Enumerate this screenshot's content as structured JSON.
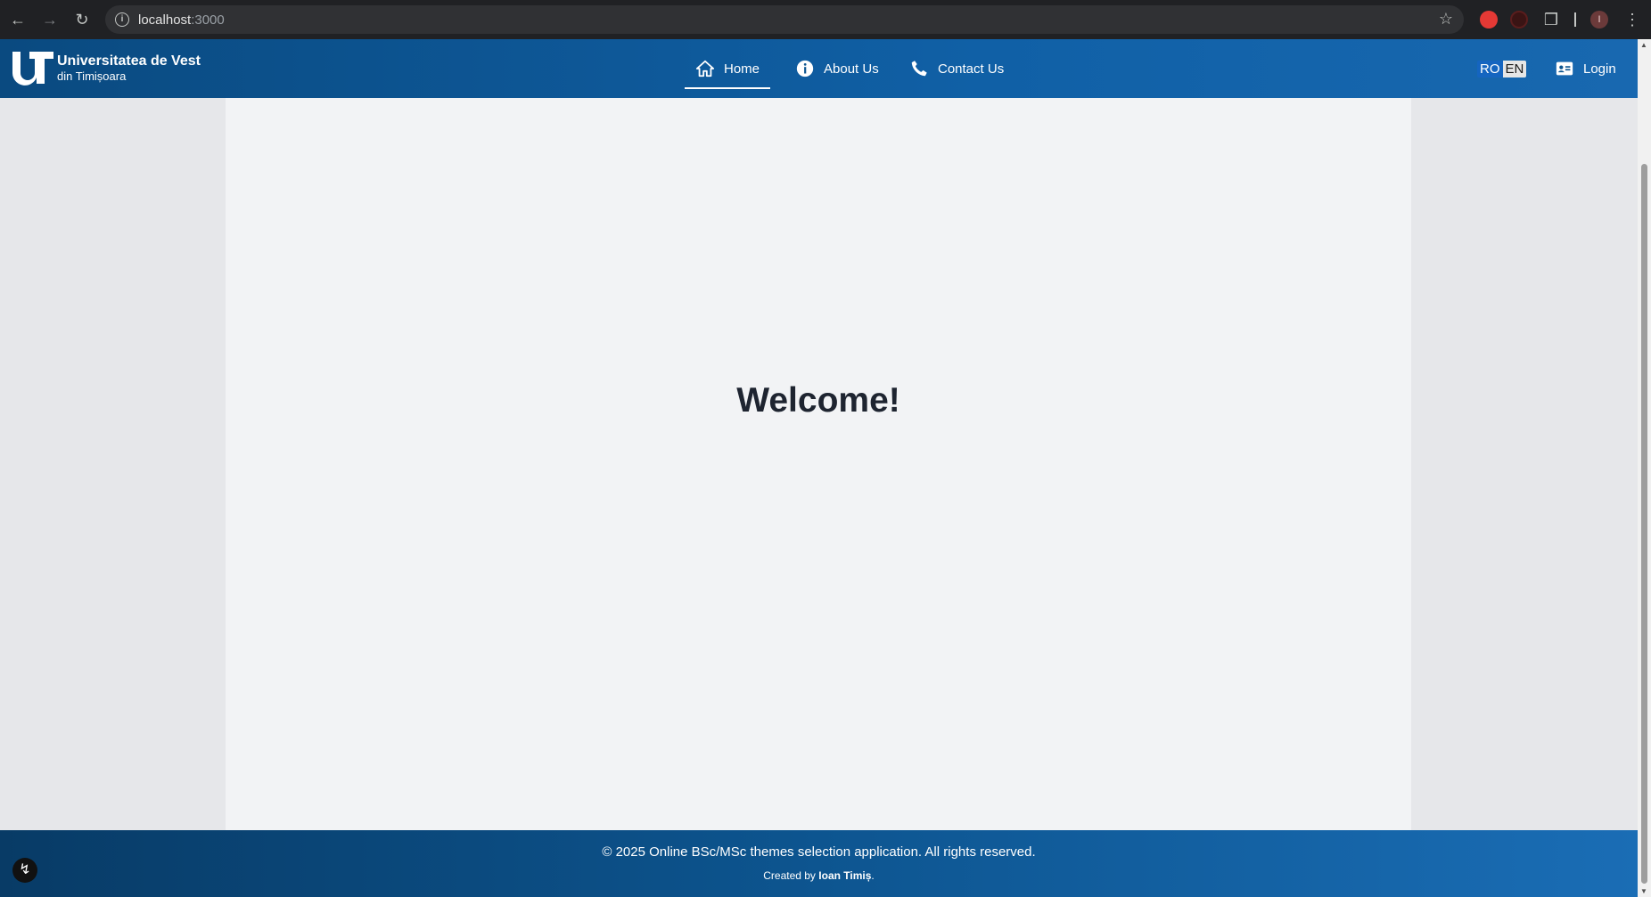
{
  "browser": {
    "url_host": "localhost",
    "url_port": ":3000",
    "profile_initial": "I"
  },
  "header": {
    "logo": {
      "line1": "Universitatea de Vest",
      "line2": "din Timișoara"
    },
    "nav": [
      {
        "label": "Home",
        "icon": "home-icon",
        "active": true
      },
      {
        "label": "About Us",
        "icon": "info-icon",
        "active": false
      },
      {
        "label": "Contact Us",
        "icon": "phone-icon",
        "active": false
      }
    ],
    "languages": {
      "ro": "RO",
      "en": "EN",
      "selected": "RO"
    },
    "login_label": "Login"
  },
  "main": {
    "heading": "Welcome!"
  },
  "footer": {
    "copyright": "© 2025 Online BSc/MSc themes selection application. All rights reserved.",
    "created_prefix": "Created by ",
    "author": "Ioan Timiș",
    "created_suffix": "."
  },
  "colors": {
    "header": "#0d5590",
    "content_bg": "#f2f3f5",
    "page_bg": "#e6e7ea",
    "lang_selected": "#1565c0"
  }
}
